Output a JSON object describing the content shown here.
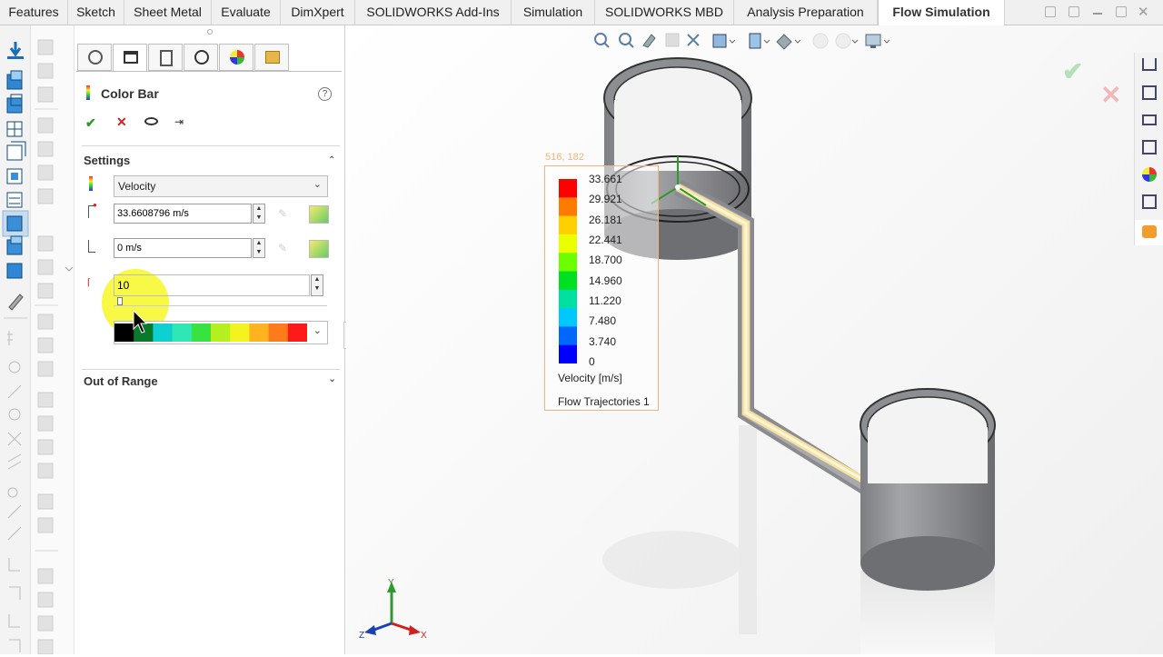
{
  "tabs": [
    {
      "label": "Features"
    },
    {
      "label": "Sketch"
    },
    {
      "label": "Sheet Metal"
    },
    {
      "label": "Evaluate"
    },
    {
      "label": "DimXpert"
    },
    {
      "label": "SOLIDWORKS Add-Ins"
    },
    {
      "label": "Simulation"
    },
    {
      "label": "SOLIDWORKS MBD"
    },
    {
      "label": "Analysis Preparation"
    },
    {
      "label": "Flow Simulation"
    }
  ],
  "panel": {
    "title": "Color Bar",
    "help_icon": "help-icon",
    "actions": {
      "ok": "ok-icon",
      "cancel": "cancel-icon",
      "preview": "eye-icon",
      "pin": "pin-icon"
    },
    "settings": {
      "header": "Settings",
      "parameter": "Velocity",
      "max_value": "33.6608796 m/s",
      "min_value": "0 m/s",
      "levels": "10",
      "palette_colors": [
        "#000000",
        "#0a7a2a",
        "#0fd0d0",
        "#2fe6b5",
        "#38e33f",
        "#b4f01f",
        "#f3f31f",
        "#ffb31f",
        "#ff7a1a",
        "#ff1a1a"
      ]
    },
    "out_of_range": {
      "header": "Out of Range"
    }
  },
  "viewport": {
    "legend": {
      "coords": "516, 182",
      "ticks": [
        "33.661",
        "29.921",
        "26.181",
        "22.441",
        "18.700",
        "14.960",
        "11.220",
        "7.480",
        "3.740",
        "0"
      ],
      "title": "Velocity [m/s]",
      "subtitle": "Flow Trajectories 1",
      "colors": [
        "#ff0000",
        "#ff7a00",
        "#ffd000",
        "#eaff00",
        "#6bff00",
        "#00e020",
        "#00e0a0",
        "#00c8ff",
        "#0068ff",
        "#0000ff"
      ]
    },
    "triad": {
      "x": "X",
      "y": "Y",
      "z": "Z"
    }
  },
  "colors": {
    "accent": "#f2b47a",
    "ok": "#2e9a2e",
    "cancel": "#d02020",
    "highlight": "#f5f500"
  }
}
